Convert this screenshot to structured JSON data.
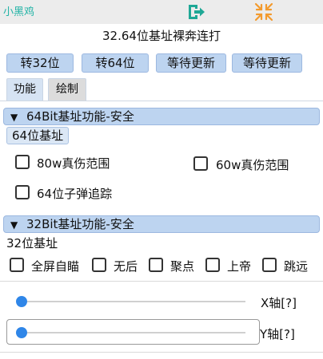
{
  "window": {
    "app_title": "小黑鸡",
    "exit_icon": "exit-icon",
    "collapse_icon": "collapse-icon",
    "colors": {
      "accent": "#2f86e8",
      "button_fill": "#bdd4f0",
      "exit_icon": "#1fa896",
      "collapse_icon": "#f39a2d"
    }
  },
  "panel": {
    "title": "32.64位基址裸奔连打"
  },
  "buttons": [
    {
      "label": "转32位"
    },
    {
      "label": "转64位"
    },
    {
      "label": "等待更新"
    },
    {
      "label": "等待更新"
    }
  ],
  "tabs": [
    {
      "label": "功能",
      "active": true
    },
    {
      "label": "绘制",
      "active": false
    }
  ],
  "section64": {
    "title": "64Bit基址功能-安全",
    "sub_label": "64位基址",
    "options": [
      {
        "label": "80w真伤范围",
        "checked": false
      },
      {
        "label": "60w真伤范围",
        "checked": false
      },
      {
        "label": "64位子弹追踪",
        "checked": false
      }
    ]
  },
  "section32": {
    "title": "32Bit基址功能-安全",
    "sub_label": "32位基址",
    "options": [
      {
        "label": "全屏自瞄",
        "checked": false
      },
      {
        "label": "无后",
        "checked": false
      },
      {
        "label": "聚点",
        "checked": false
      },
      {
        "label": "上帝",
        "checked": false
      },
      {
        "label": "跳远",
        "checked": false
      }
    ]
  },
  "sliders": [
    {
      "label": "X轴[?]",
      "value": 0
    },
    {
      "label": "Y轴[?]",
      "value": 0
    }
  ]
}
